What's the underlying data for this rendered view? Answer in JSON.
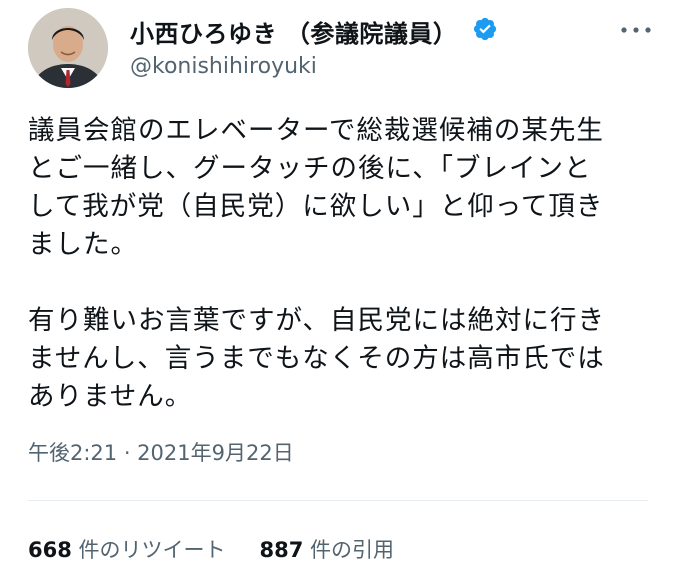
{
  "author": {
    "display_name": "小西ひろゆき （参議院議員）",
    "handle": "@konishihiroyuki",
    "verified": true
  },
  "tweet": {
    "paragraph1": [
      "議員会館のエレベーターで総裁選候補の某先生",
      "とご一緒し、グータッチの後に、「ブレインと",
      "して我が党（自民党）に欲しい」と仰って頂き",
      "ました。"
    ],
    "paragraph2": [
      "有り難いお言葉ですが、自民党には絶対に行き",
      "ませんし、言うまでもなくその方は高市氏では",
      "ありません。"
    ],
    "timestamp": "午後2:21 · 2021年9月22日"
  },
  "stats": {
    "retweets_count": "668",
    "retweets_label": " 件のリツイート",
    "quotes_count": "887",
    "quotes_label": " 件の引用"
  },
  "icons": {
    "verified": "verified-badge-icon",
    "more": "more-options-icon"
  },
  "colors": {
    "text": "#0f1419",
    "secondary": "#536471",
    "verified": "#1d9bf0",
    "divider": "#e6ecf0"
  }
}
